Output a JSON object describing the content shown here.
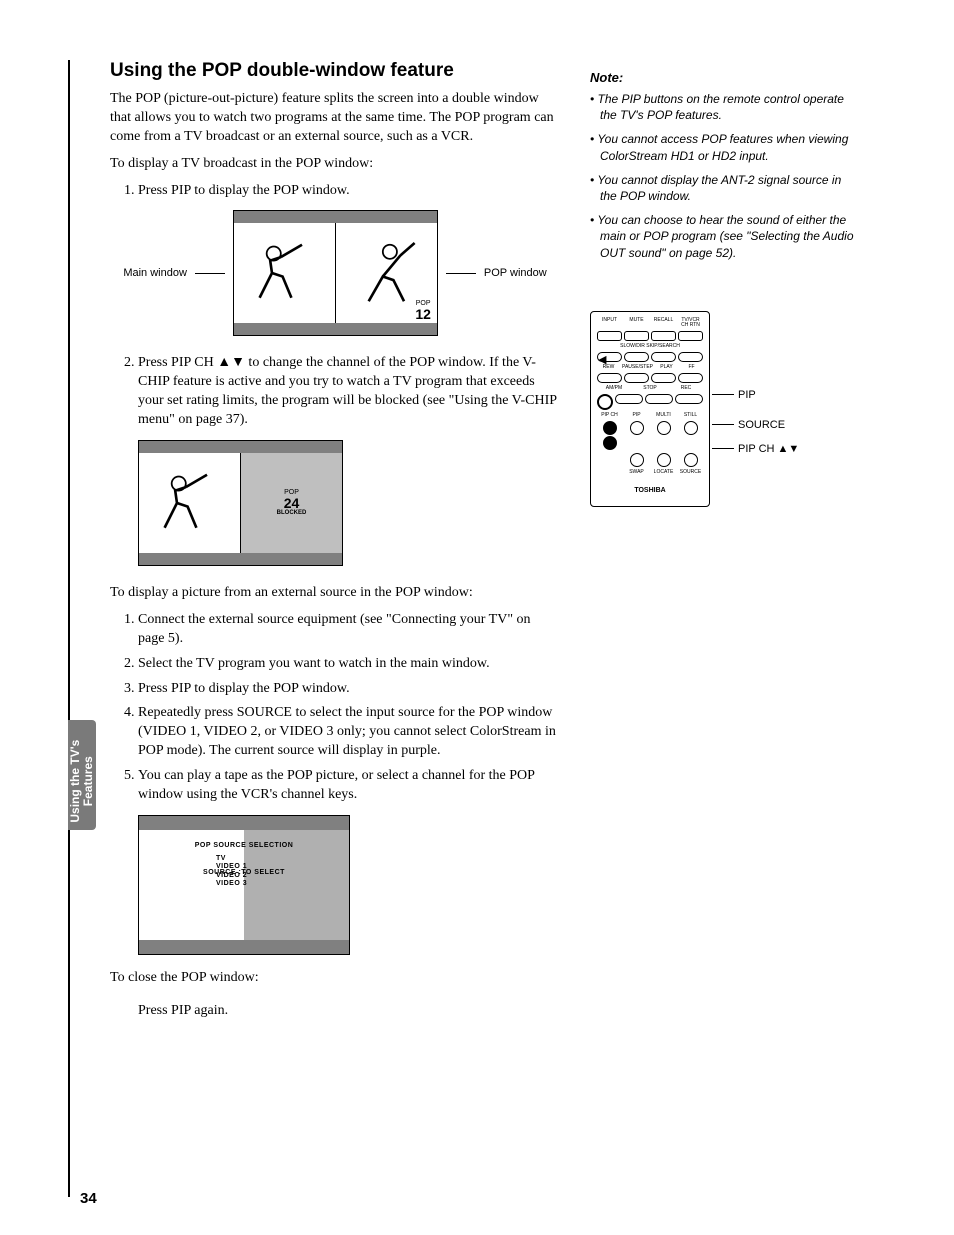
{
  "heading": "Using the POP double-window feature",
  "intro": "The POP (picture-out-picture) feature splits the screen into a double window that allows you to watch two programs at the same time. The POP program can come from a TV broadcast or an external source, such as a VCR.",
  "lead1": "To display a TV broadcast in the POP window:",
  "steps_a": [
    "Press PIP to display the POP window.",
    "Press PIP CH ▲▼ to change the channel of the POP window. If the V-CHIP feature is active and you try to watch a TV program that exceeds your set rating limits, the program will be blocked (see \"Using the V-CHIP menu\" on page 37)."
  ],
  "fig1": {
    "left_label": "Main window",
    "right_label": "POP window",
    "pop_label": "POP",
    "pop_channel": "12"
  },
  "fig2": {
    "pop_label": "POP",
    "pop_channel": "24",
    "blocked": "BLOCKED"
  },
  "lead2": "To display a picture from an external source in the POP window:",
  "steps_b": [
    "Connect the external source equipment (see \"Connecting your TV\" on page 5).",
    "Select the TV program you want to watch in the main window.",
    "Press PIP to display the POP window.",
    "Repeatedly press SOURCE to select the input source for the POP window (VIDEO 1, VIDEO 2, or VIDEO 3 only; you cannot select ColorStream in POP mode). The current source will display in purple.",
    "You can play a tape as the POP picture, or select a channel for the POP window using the VCR's channel keys."
  ],
  "osd": {
    "title": "POP SOURCE SELECTION",
    "items": [
      "TV",
      "VIDEO 1",
      "VIDEO 2",
      "VIDEO 3"
    ],
    "footer": "SOURCE :TO SELECT"
  },
  "close_lead": "To close the POP window:",
  "close_step": "Press PIP again.",
  "note_heading": "Note:",
  "notes": [
    "The PIP buttons on the remote control operate the TV's POP features.",
    "You cannot access POP features when viewing ColorStream HD1 or HD2 input.",
    "You cannot display the ANT-2 signal source in the POP window.",
    "You can choose to hear the sound of either the main or POP program (see \"Selecting the Audio OUT sound\" on page 52)."
  ],
  "remote": {
    "brand": "TOSHIBA",
    "callouts": [
      "PIP",
      "SOURCE",
      "PIP CH ▲▼"
    ],
    "top_labels": [
      "INPUT",
      "MUTE",
      "RECALL",
      "TV/VCR CH RTN"
    ],
    "row2": "SLOW/DIR           SKIP/SEARCH",
    "row4": [
      "REW",
      "PAUSE/STEP",
      "PLAY",
      "FF"
    ],
    "row6": [
      "AM/PM",
      "STOP",
      "REC"
    ],
    "row8": [
      "PIP CH",
      "PIP",
      "MULTI",
      "STILL"
    ],
    "row10": [
      "SWAP",
      "LOCATE",
      "SOURCE"
    ]
  },
  "side_tab": "Using the TV's Features",
  "page_number": "34"
}
